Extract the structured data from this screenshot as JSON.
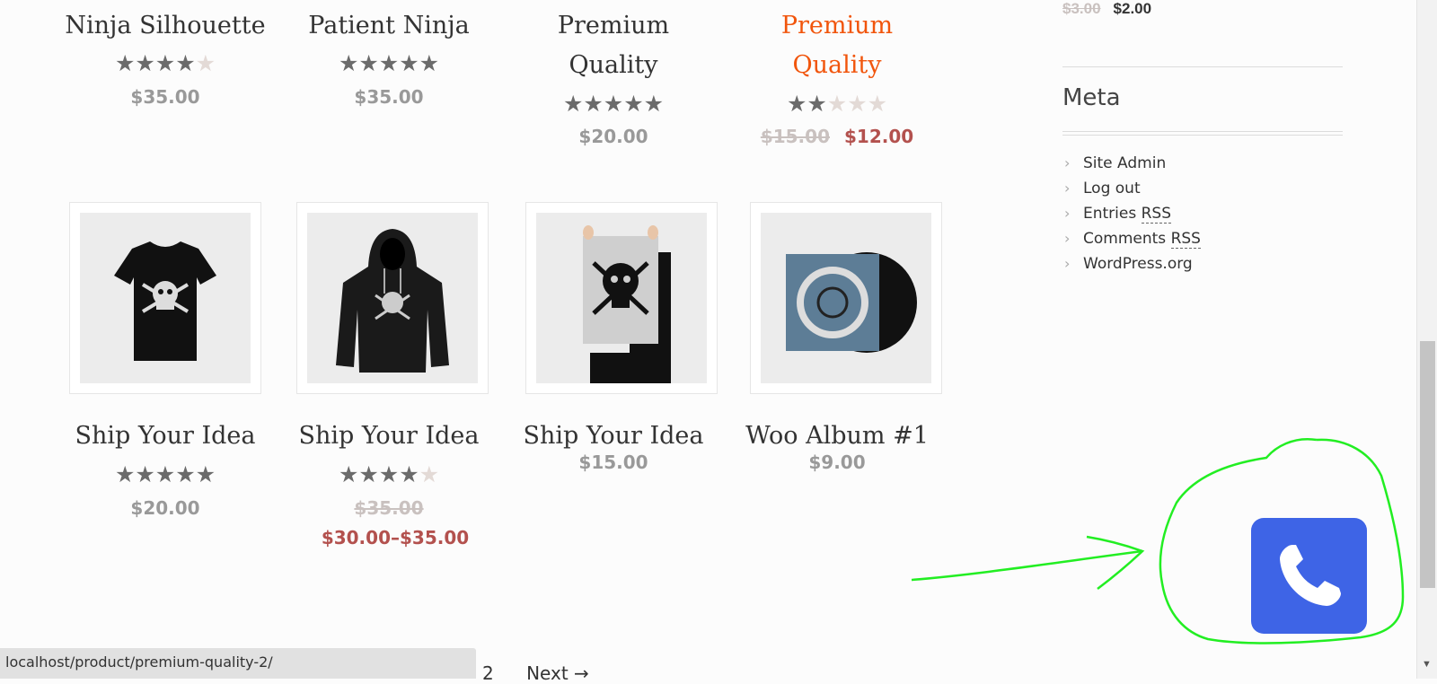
{
  "products_row1": [
    {
      "title_line1": "Ninja Silhouette",
      "title_line2": "",
      "rating": 4,
      "price": "$35.00",
      "old_price": "",
      "sale_price": "",
      "highlight": false
    },
    {
      "title_line1": "Patient Ninja",
      "title_line2": "",
      "rating": 5,
      "price": "$35.00",
      "old_price": "",
      "sale_price": "",
      "highlight": false
    },
    {
      "title_line1": "Premium",
      "title_line2": "Quality",
      "rating": 4.5,
      "price": "$20.00",
      "old_price": "",
      "sale_price": "",
      "highlight": false
    },
    {
      "title_line1": "Premium",
      "title_line2": "Quality",
      "rating": 2,
      "price": "",
      "old_price": "$15.00",
      "sale_price": "$12.00",
      "highlight": true
    }
  ],
  "products_row2": [
    {
      "title": "Ship Your Idea",
      "image": "tshirt-skull",
      "rating": 4.5,
      "price": "$20.00",
      "old_price": "",
      "sale_price": ""
    },
    {
      "title": "Ship Your Idea",
      "image": "hoodie-skull",
      "rating": 4.5,
      "price": "",
      "old_price": "$35.00",
      "sale_price": "$30.00–$35.00"
    },
    {
      "title": "Ship Your Idea",
      "image": "poster-skull",
      "rating": null,
      "price": "$15.00",
      "old_price": "",
      "sale_price": ""
    },
    {
      "title": "Woo Album #1",
      "image": "vinyl-record",
      "rating": null,
      "price": "$9.00",
      "old_price": "",
      "sale_price": ""
    }
  ],
  "sidebar": {
    "top_old_price": "$3.00",
    "top_price": "$2.00",
    "meta_title": "Meta",
    "meta_links": [
      {
        "label": "Site Admin",
        "abbr": ""
      },
      {
        "label": "Log out",
        "abbr": ""
      },
      {
        "label": "Entries ",
        "abbr": "RSS"
      },
      {
        "label": "Comments ",
        "abbr": "RSS"
      },
      {
        "label": "WordPress.org",
        "abbr": ""
      }
    ]
  },
  "status_bar": {
    "url": "localhost/product/premium-quality-2/"
  },
  "pagination": {
    "page": "2",
    "next": "Next →"
  },
  "floating": {
    "icon": "phone-icon",
    "color": "#3e64e6"
  },
  "annotation": {
    "color": "#22ee22"
  }
}
